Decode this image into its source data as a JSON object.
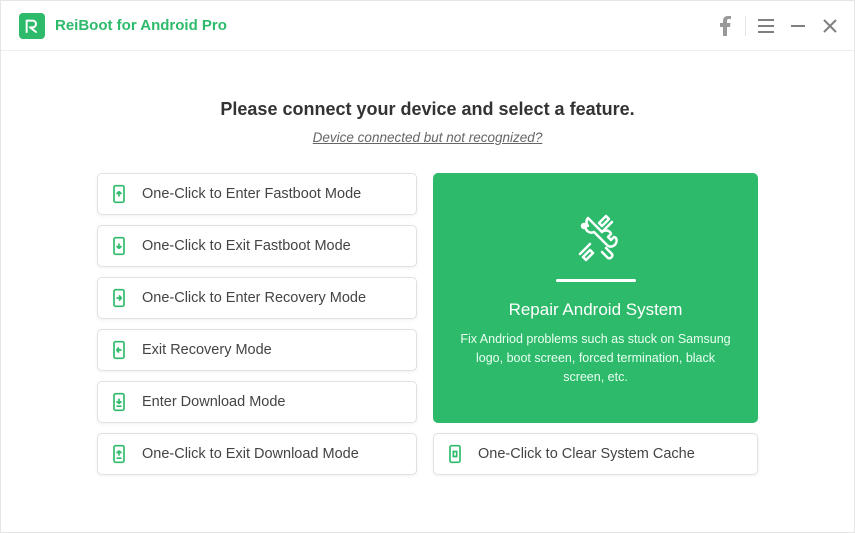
{
  "header": {
    "app_title": "ReiBoot for Android Pro",
    "logo_letter": "R"
  },
  "main": {
    "heading": "Please connect your device and select a feature.",
    "help_link": "Device connected but not recognized?"
  },
  "actions": {
    "enter_fastboot": "One-Click to Enter Fastboot Mode",
    "exit_fastboot": "One-Click to Exit Fastboot Mode",
    "enter_recovery": "One-Click to Enter Recovery Mode",
    "exit_recovery": "Exit Recovery Mode",
    "enter_download": "Enter Download Mode",
    "exit_download": "One-Click to Exit Download Mode",
    "clear_cache": "One-Click to Clear System Cache"
  },
  "repair_card": {
    "title": "Repair Android System",
    "description": "Fix Andriod problems such as stuck on Samsung logo, boot screen, forced termination, black screen, etc."
  },
  "colors": {
    "brand": "#2dbb6b"
  }
}
